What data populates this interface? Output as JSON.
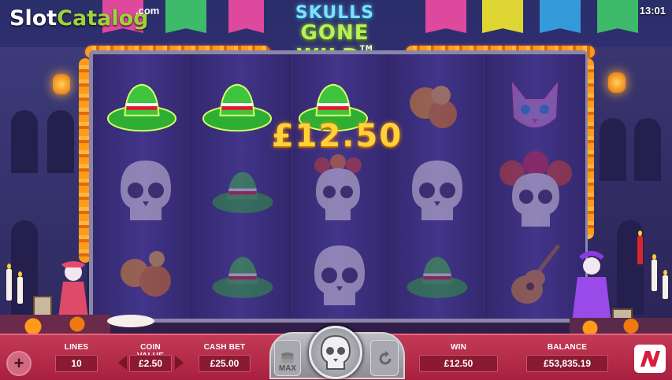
{
  "brand": {
    "name_left": "Slot",
    "name_right": "Catalog",
    "tld": ".com"
  },
  "game": {
    "title_line1": "SKULLS",
    "title_line2": "GONE WILD",
    "trademark": "TM"
  },
  "clock": "13:01",
  "win_overlay": "£12.50",
  "reels": [
    [
      "sombrero",
      "skull",
      "marigolds"
    ],
    [
      "sombrero",
      "sombrero",
      "sombrero"
    ],
    [
      "sombrero",
      "frida-skull",
      "skull"
    ],
    [
      "marigolds",
      "skull",
      "sombrero"
    ],
    [
      "cat-mask",
      "catrina-skull",
      "guitar"
    ]
  ],
  "highlighted_row": 0,
  "controls": {
    "lines_label": "LINES",
    "lines_value": "10",
    "coin_value_label": "COIN VALUE",
    "coin_value": "£2.50",
    "cash_bet_label": "CASH BET",
    "cash_bet_value": "£25.00",
    "max_label": "MAX",
    "win_label": "WIN",
    "win_value": "£12.50",
    "balance_label": "BALANCE",
    "balance_value": "£53,835.19",
    "plus_symbol": "+"
  },
  "colors": {
    "bottom_bar": "#b32c4a",
    "win_gold": "#ffd23a",
    "sombrero_green": "#39c23a",
    "marigold": "#ff9a1a",
    "reel_bg": "#3a2d7a"
  },
  "icons": [
    "plus-icon",
    "coin-stack-icon",
    "skull-spin-icon",
    "autoplay-arrow-icon",
    "netent-n-logo-icon"
  ]
}
